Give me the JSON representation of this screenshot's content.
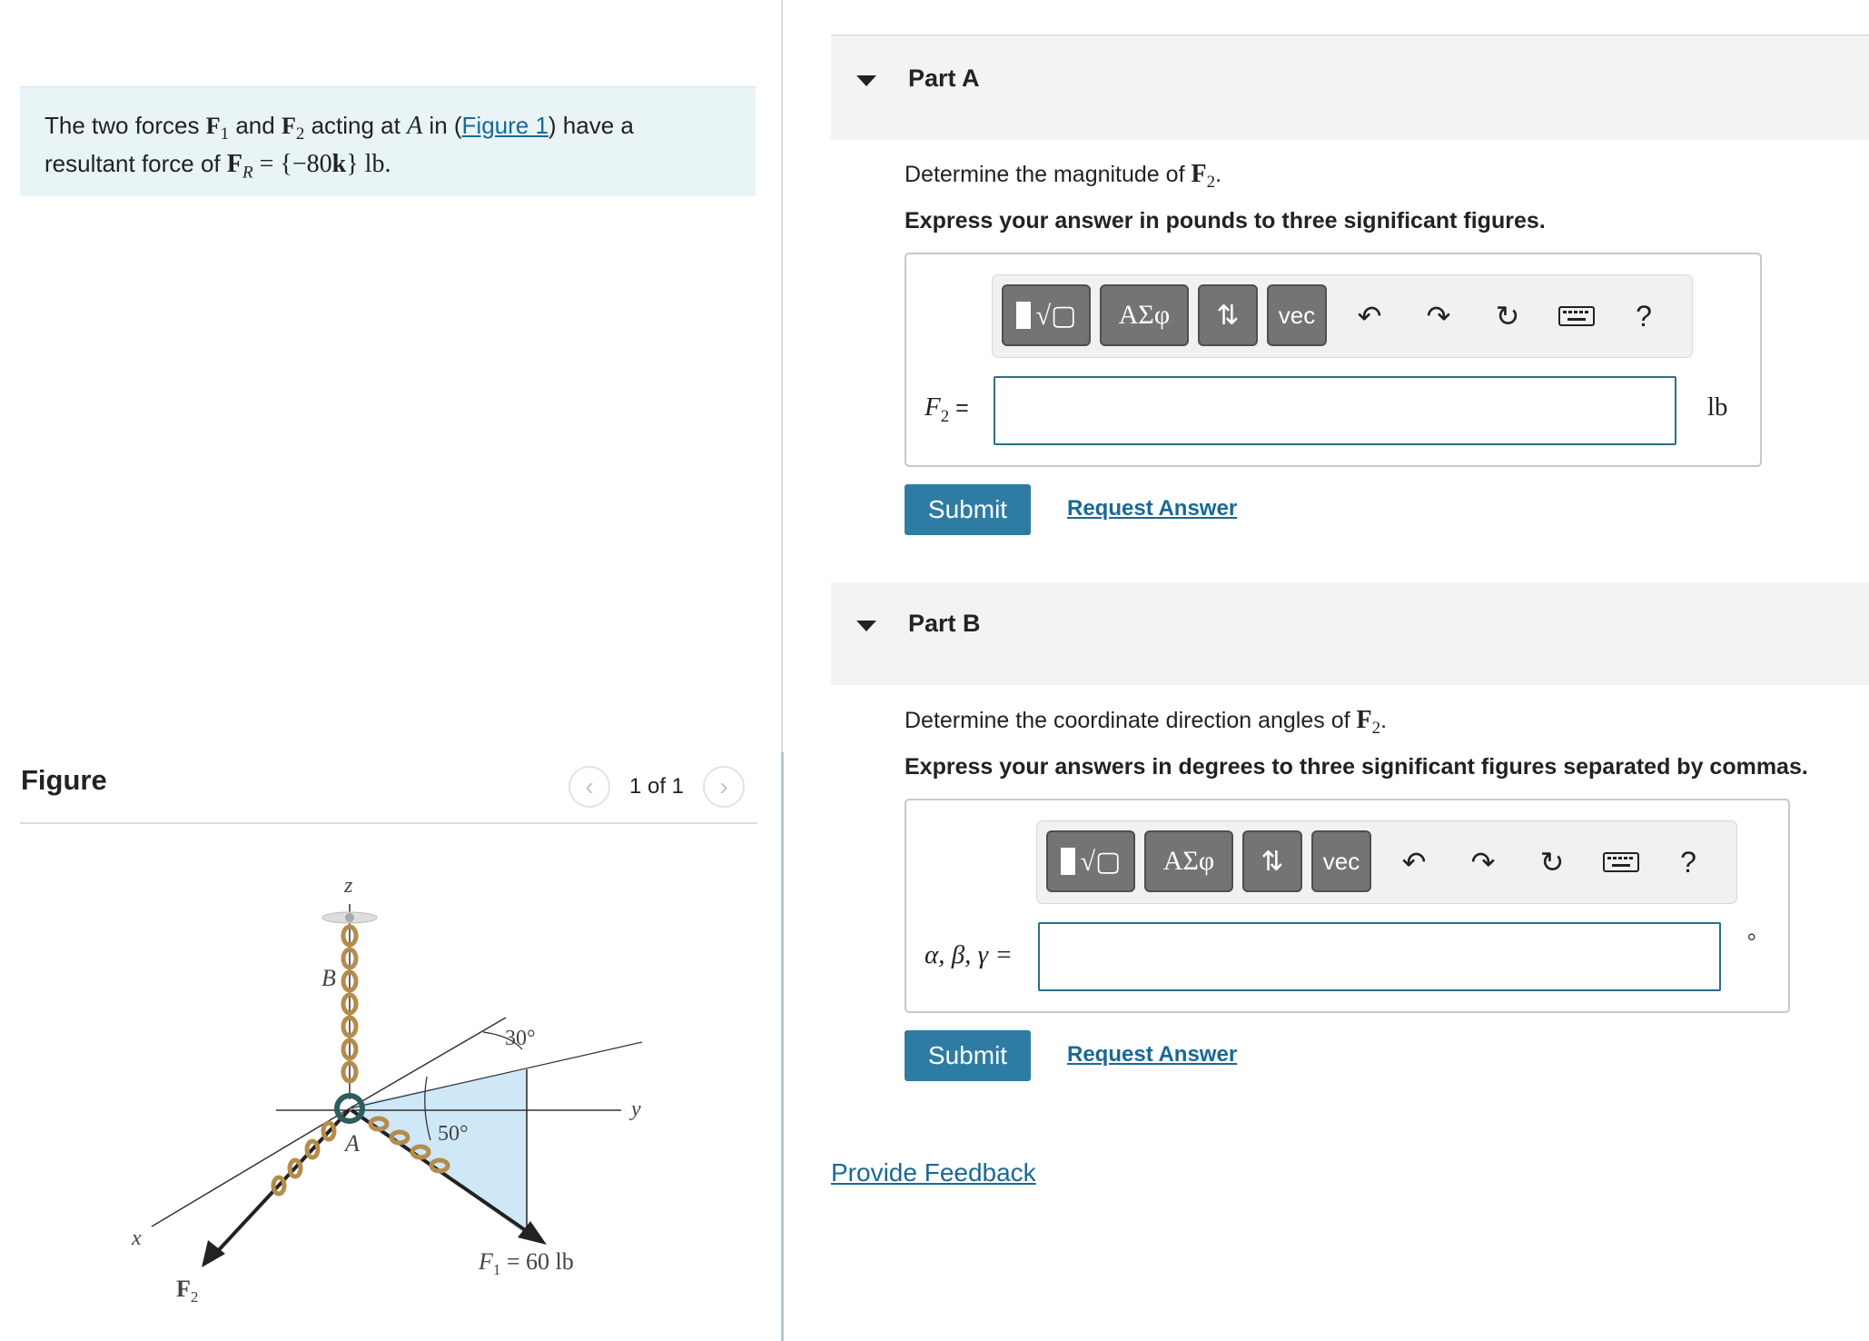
{
  "problem": {
    "text_prefix": "The two forces ",
    "f1": "F",
    "f1_sub": "1",
    "and": " and ",
    "f2": "F",
    "f2_sub": "2",
    "acting_at": " acting at ",
    "point": "A",
    "in_open": " in (",
    "figure_link": "Figure 1",
    "in_close": ") have a",
    "line2_prefix": "resultant force of ",
    "fr": "F",
    "fr_sub": "R",
    "fr_value": " = {−80",
    "fr_k": "k",
    "fr_unit": "} lb."
  },
  "figure_panel": {
    "title": "Figure",
    "page_count": "1 of 1",
    "prev_icon": "chevron-left-icon",
    "next_icon": "chevron-right-icon",
    "labels": {
      "z": "z",
      "y": "y",
      "x": "x",
      "B": "B",
      "A": "A",
      "angle30": "30°",
      "angle50": "50°",
      "f1_label": "F",
      "f1_sub": "1",
      "f1_value": " = 60 lb",
      "f2_label": "F",
      "f2_sub": "2"
    }
  },
  "part_a": {
    "header": "Part A",
    "prompt_prefix": "Determine the magnitude of ",
    "prompt_var": "F",
    "prompt_sub": "2",
    "prompt_suffix": ".",
    "instruction": "Express your answer in pounds to three significant figures.",
    "var_label": "F",
    "var_sub": "2",
    "var_eq": " =",
    "input_value": "",
    "unit": "lb",
    "submit": "Submit",
    "request": "Request Answer"
  },
  "part_b": {
    "header": "Part B",
    "prompt_prefix": "Determine the coordinate direction angles of ",
    "prompt_var": "F",
    "prompt_sub": "2",
    "prompt_suffix": ".",
    "instruction": "Express your answers in degrees to three significant figures separated by commas.",
    "var_label": "α, β, γ =",
    "input_value": "",
    "unit": "°",
    "submit": "Submit",
    "request": "Request Answer"
  },
  "toolbar": {
    "templates": "√▢",
    "greek": "ΑΣφ",
    "arrows": "⇅",
    "vec": "vec",
    "help": "?",
    "icons": [
      "templates-icon",
      "greek-icon",
      "sort-arrows-icon",
      "vec-icon",
      "undo-icon",
      "redo-icon",
      "reset-icon",
      "keyboard-icon",
      "help-icon"
    ]
  },
  "feedback": "Provide Feedback",
  "colors": {
    "problem_bg": "#e8f4f6",
    "submit_bg": "#2e7ca3",
    "link": "#1a6896",
    "input_border": "#2a6f85",
    "figure_plane": "#cfe8f7"
  }
}
